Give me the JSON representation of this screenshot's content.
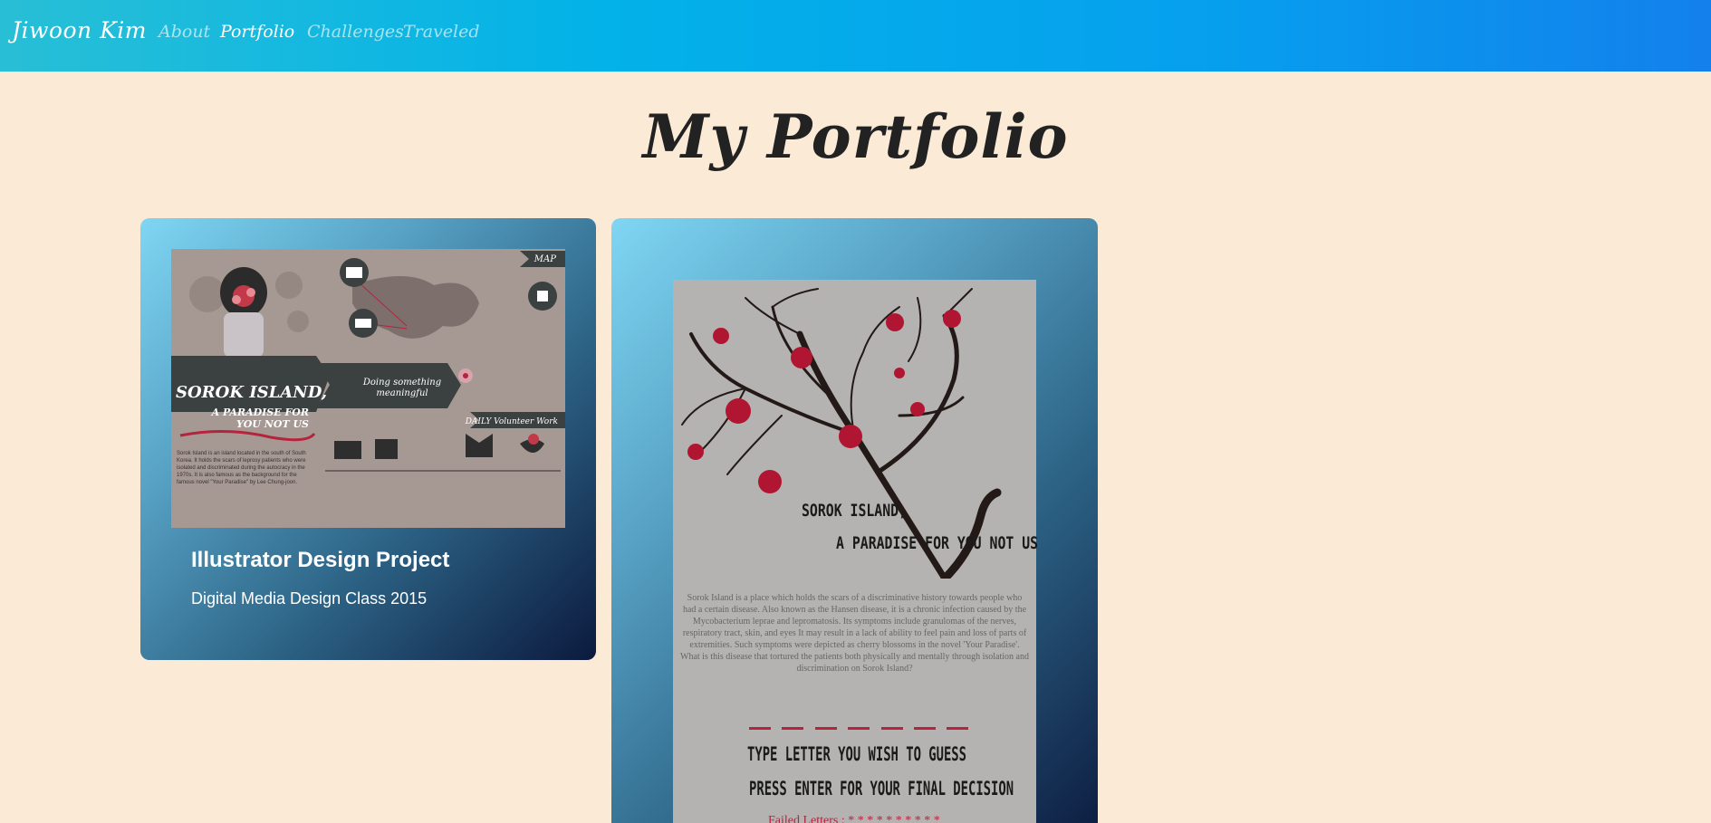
{
  "nav": {
    "brand": "Jiwoon Kim",
    "links": [
      {
        "label": "About",
        "active": false
      },
      {
        "label": "Portfolio",
        "active": true
      },
      {
        "label": "Challenges",
        "active": false
      },
      {
        "label": "Traveled",
        "active": false
      }
    ]
  },
  "page": {
    "title": "My Portfolio"
  },
  "cards": [
    {
      "title": "Illustrator Design Project",
      "subtitle": "Digital Media Design Class 2015",
      "image": {
        "heading": "SOROK ISLAND,",
        "subheading": "A PARADISE FOR YOU NOT US",
        "center_text": "Doing something meaningful",
        "map_label": "MAP",
        "daily_label": "DAILY Volunteer Work",
        "body": "Sorok Island is an island located in the south of South Korea. It holds the scars of leprosy patients who were isolated and discriminated during the autocracy in the 1970s. It is also famous as the background for the famous novel \"Your Paradise\" by Lee Chung-joon."
      }
    },
    {
      "title": "",
      "subtitle": "",
      "image": {
        "heading_line1": "SOROK ISLAND,",
        "heading_line2": "A PARADISE FOR YOU NOT US",
        "description": "Sorok Island is a place which holds the scars of a discriminative history towards people who had a certain disease. Also known as the Hansen disease, it is a chronic infection caused by the Mycobacterium leprae and lepromatosis. Its symptoms include granulomas of the nerves, respiratory tract, skin, and eyes It may result in a lack of ability to feel pain and loss of parts of extremities. Such symptoms were depicted as cherry blossoms in the novel 'Your Paradise'. What is this disease that tortured the patients both physically and mentally through isolation and discrimination on Sorok Island?",
        "prompt1": "TYPE LETTER YOU WISH TO GUESS",
        "prompt2": "PRESS ENTER FOR YOUR FINAL DECISION",
        "failed": "Failed Letters :  * * * * * * * * * *"
      }
    }
  ],
  "colors": {
    "background": "#fbebd6",
    "nav_gradient_start": "#28bfd6",
    "nav_gradient_end": "#1380ec",
    "accent_red": "#b6233d"
  }
}
